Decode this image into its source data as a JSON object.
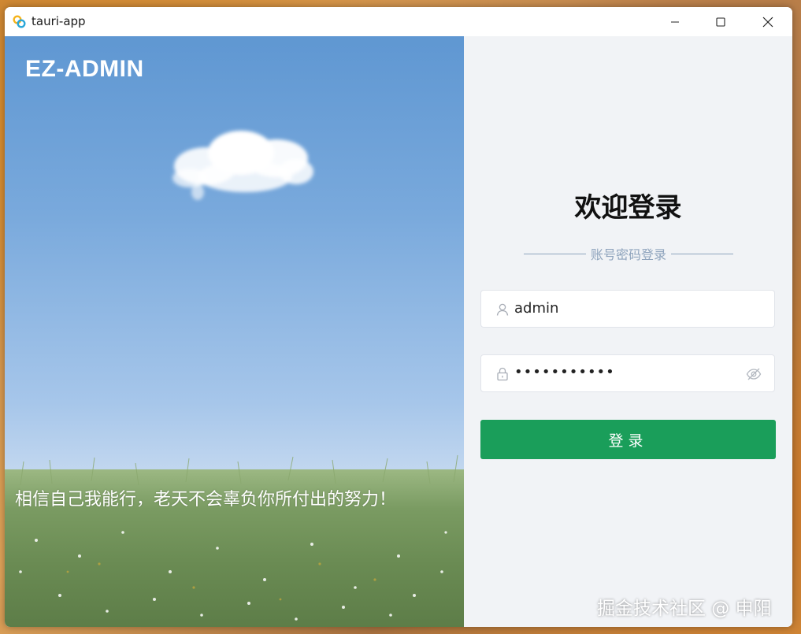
{
  "window": {
    "title": "tauri-app"
  },
  "left_panel": {
    "brand": "EZ-ADMIN",
    "slogan": "相信自己我能行，老天不会辜负你所付出的努力！"
  },
  "login": {
    "heading": "欢迎登录",
    "method_label": "账号密码登录",
    "username": {
      "value": "admin",
      "icon": "user-icon"
    },
    "password": {
      "masked_value": "•••••••••••",
      "icon": "lock-icon",
      "toggle_icon": "eye-off-icon"
    },
    "submit_label": "登录"
  },
  "watermark": "掘金技术社区 @ 申阳",
  "colors": {
    "accent": "#1a9e5a",
    "right_bg": "#f1f3f6",
    "divider": "#8fa4bd"
  }
}
